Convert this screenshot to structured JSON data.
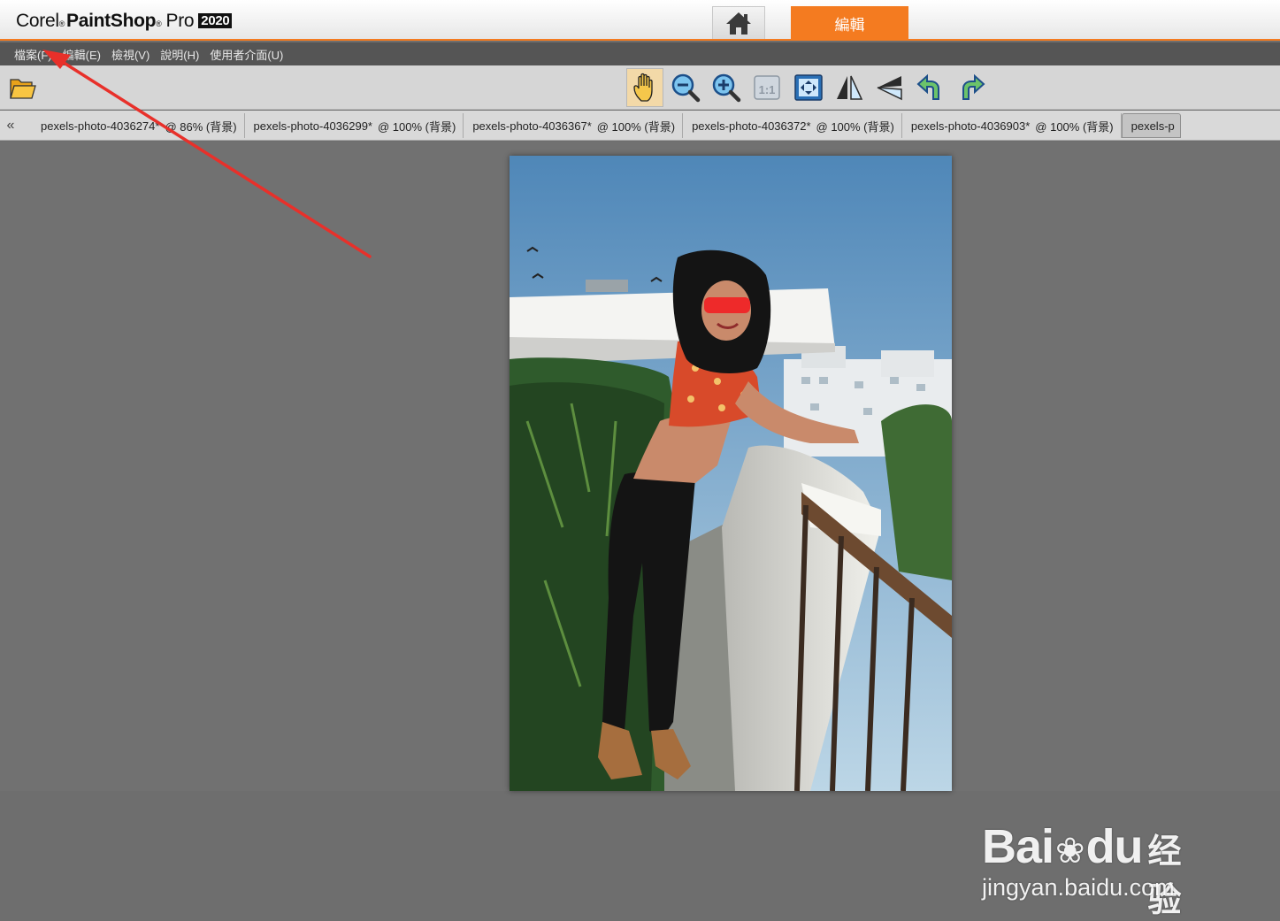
{
  "app": {
    "brand_corel": "Corel",
    "brand_paintshop": "PaintShop",
    "brand_pro": "Pro",
    "brand_year": "2020",
    "reg_mark": "®"
  },
  "top_tabs": {
    "edit_label": "編輯"
  },
  "menu": {
    "items": [
      {
        "label": "檔案(F)"
      },
      {
        "label": "編輯(E)"
      },
      {
        "label": "檢視(V)"
      },
      {
        "label": "說明(H)"
      },
      {
        "label": "使用者介面(U)"
      }
    ]
  },
  "toolbar": {
    "tools": [
      {
        "name": "open-folder-icon"
      },
      {
        "name": "pan-hand-icon",
        "active": true
      },
      {
        "name": "zoom-out-icon"
      },
      {
        "name": "zoom-in-icon"
      },
      {
        "name": "actual-size-icon",
        "label": "1:1"
      },
      {
        "name": "fit-to-window-icon"
      },
      {
        "name": "flip-horizontal-icon"
      },
      {
        "name": "flip-vertical-icon"
      },
      {
        "name": "rotate-left-icon"
      },
      {
        "name": "rotate-right-icon"
      }
    ]
  },
  "doc_tabs": {
    "scroll_left": "«",
    "tabs": [
      {
        "name": "pexels-photo-4036274*",
        "zoom": "@  86% (背景)"
      },
      {
        "name": "pexels-photo-4036299*",
        "zoom": "@ 100% (背景)"
      },
      {
        "name": "pexels-photo-4036367*",
        "zoom": "@ 100% (背景)"
      },
      {
        "name": "pexels-photo-4036372*",
        "zoom": "@ 100% (背景)"
      },
      {
        "name": "pexels-photo-4036903*",
        "zoom": "@ 100% (背景)"
      },
      {
        "name": "pexels-p",
        "zoom": ""
      }
    ]
  },
  "colors": {
    "accent": "#f47b20",
    "annotation": "#e8302a",
    "menubar": "#555555",
    "workspace": "#717171"
  },
  "watermark": {
    "brand_left": "Bai",
    "brand_right": "du",
    "brand_cn": "经验",
    "url": "jingyan.baidu.com"
  }
}
